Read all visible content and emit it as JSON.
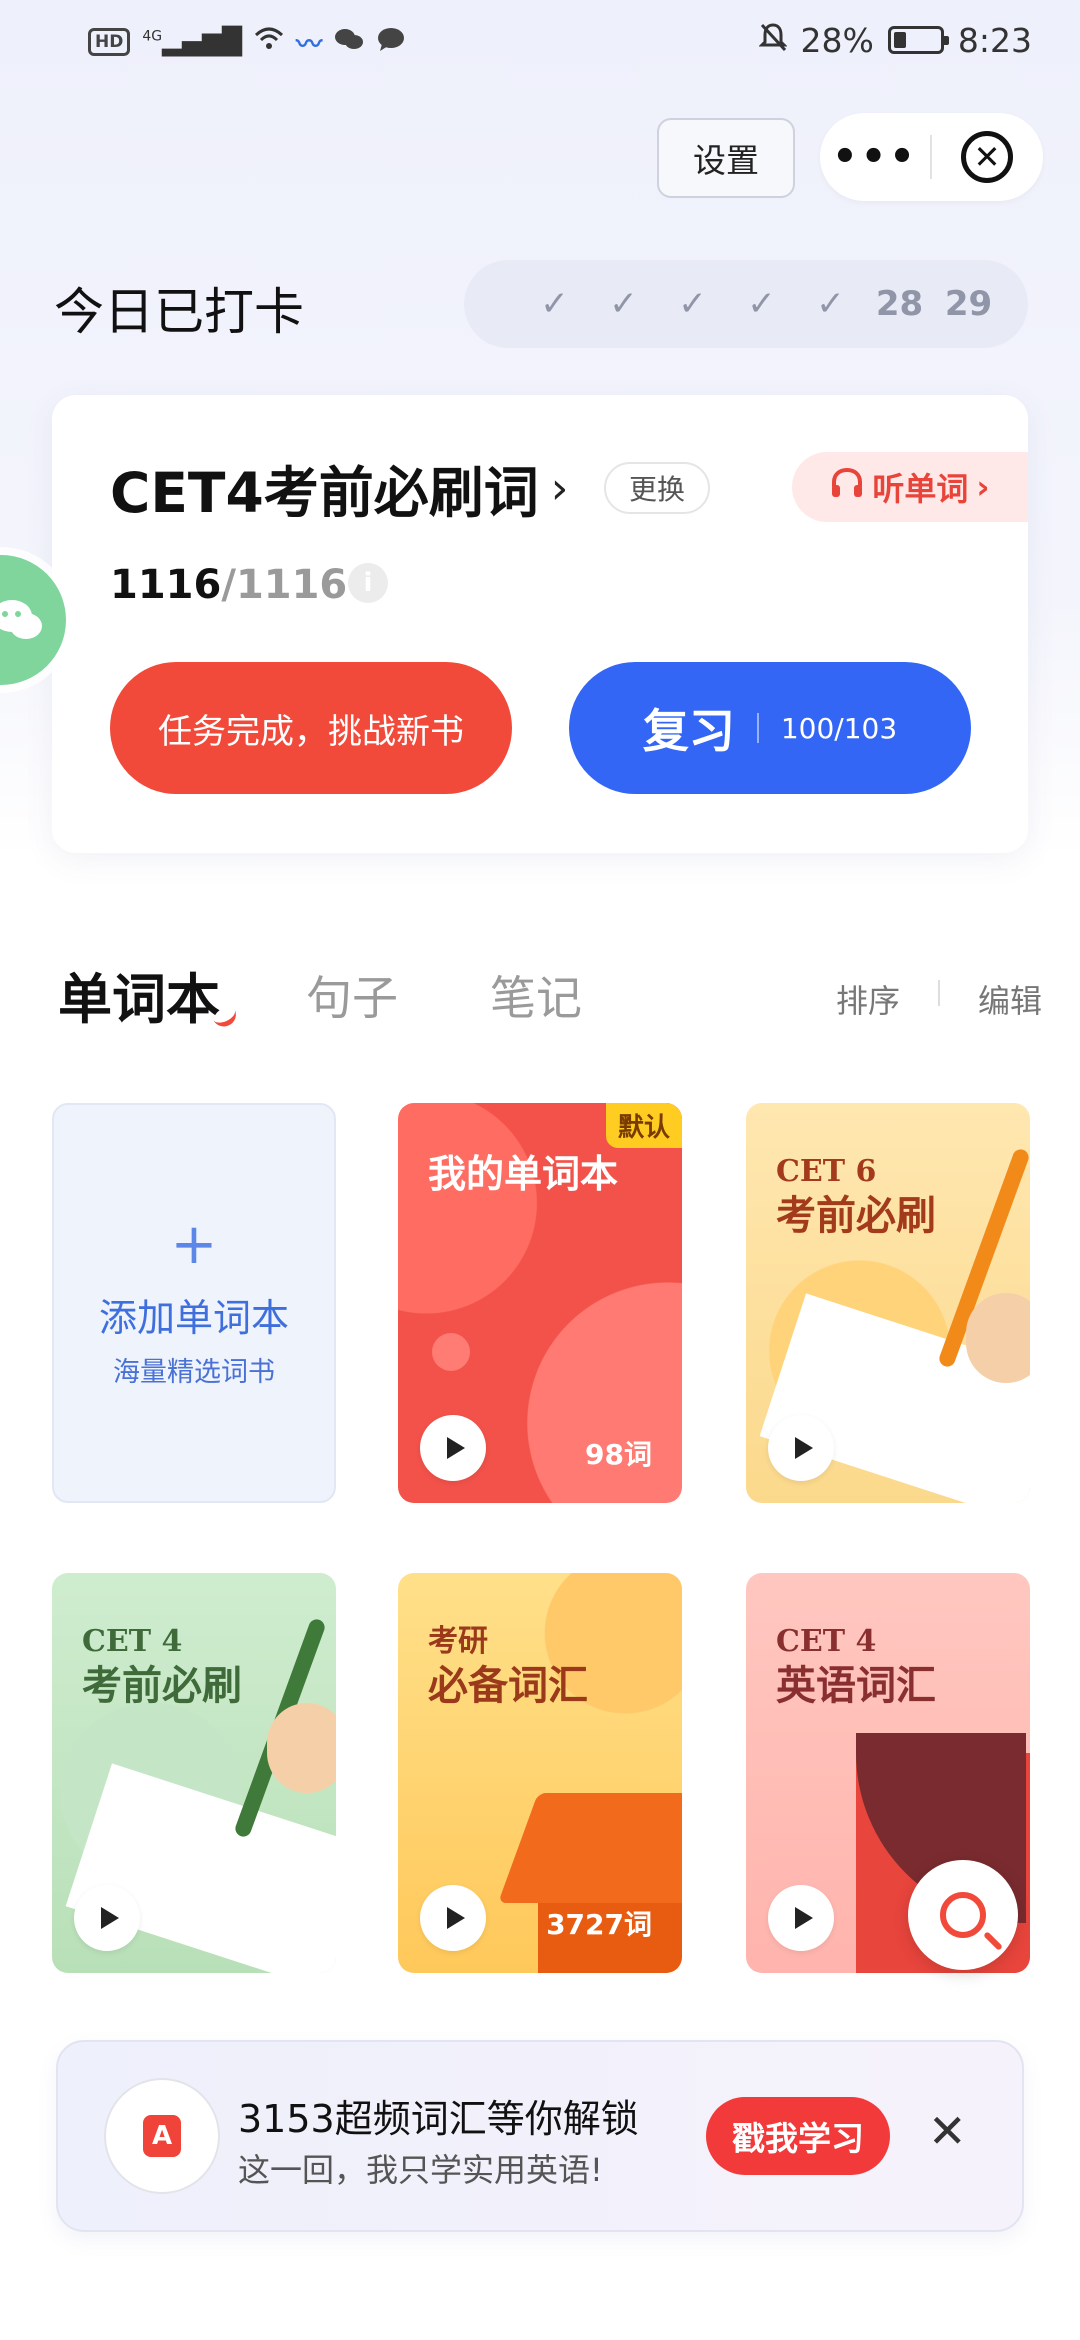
{
  "status_bar": {
    "left_icons": [
      "hd-icon",
      "signal-4g-icon",
      "wifi-icon",
      "app-notification-icon",
      "wechat-icon",
      "message-icon"
    ],
    "battery_text": "28%",
    "battery_level": 0.28,
    "time": "8:23",
    "hd_label": "HD",
    "net_label": "4G"
  },
  "header": {
    "settings_label": "设置",
    "more_label": "•••",
    "close_label": "✕"
  },
  "checkin": {
    "title": "今日已打卡",
    "days": [
      "✓",
      "✓",
      "✓",
      "✓",
      "✓",
      "28",
      "29"
    ]
  },
  "book": {
    "title": "CET4考前必刷词",
    "title_chevron": "›",
    "change_label": "更换",
    "listen_label": "听单词",
    "listen_chevron": "›",
    "progress_done": "1116",
    "progress_total": "/1116",
    "info_label": "i",
    "task_button": "任务完成，挑战新书",
    "review_button": "复习",
    "review_count": "100/103"
  },
  "tabs": {
    "items": [
      "单词本",
      "句子",
      "笔记"
    ],
    "active": 0,
    "sort_label": "排序",
    "edit_label": "编辑"
  },
  "wordbooks": {
    "add": {
      "plus": "+",
      "label": "添加单词本",
      "sub": "海量精选词书"
    },
    "my": {
      "title": "我的单词本",
      "badge": "默认",
      "count": "98词"
    },
    "cet6": {
      "small": "CET 6",
      "title": "考前必刷"
    },
    "cet4": {
      "small": "CET 4",
      "title": "考前必刷"
    },
    "kaoyan": {
      "small": "考研",
      "title": "必备词汇",
      "count": "3727词"
    },
    "cet4_vocab": {
      "small": "CET 4",
      "title": "英语词汇"
    }
  },
  "promo": {
    "logo_letter": "A",
    "title": "3153超频词汇等你解锁",
    "subtitle": "这一回，我只学实用英语!",
    "cta": "戳我学习",
    "close": "✕"
  },
  "colors": {
    "accent_red": "#f24a3a",
    "accent_blue": "#3366f5",
    "wechat_green": "#7fd59c"
  }
}
